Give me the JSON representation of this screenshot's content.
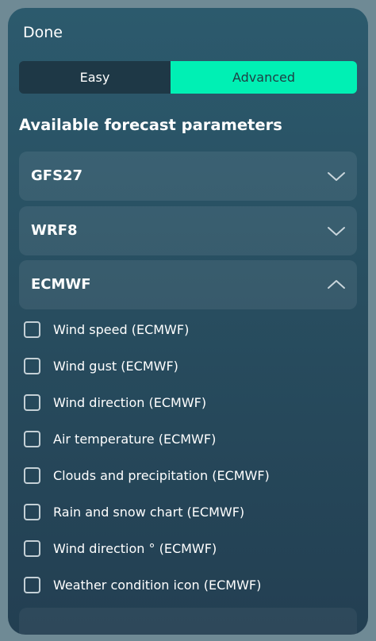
{
  "header": {
    "done_label": "Done"
  },
  "mode_switch": {
    "easy_label": "Easy",
    "advanced_label": "Advanced",
    "selected": "Advanced"
  },
  "section": {
    "title": "Available forecast parameters"
  },
  "models": [
    {
      "label": "GFS27",
      "expanded": false
    },
    {
      "label": "WRF8",
      "expanded": false
    },
    {
      "label": "ECMWF",
      "expanded": true
    }
  ],
  "ecmwf_params": [
    {
      "label": "Wind speed (ECMWF)",
      "checked": false
    },
    {
      "label": "Wind gust (ECMWF)",
      "checked": false
    },
    {
      "label": "Wind direction (ECMWF)",
      "checked": false
    },
    {
      "label": "Air temperature (ECMWF)",
      "checked": false
    },
    {
      "label": "Clouds and precipitation (ECMWF)",
      "checked": false
    },
    {
      "label": "Rain and snow chart (ECMWF)",
      "checked": false
    },
    {
      "label": "Wind direction ° (ECMWF)",
      "checked": false
    },
    {
      "label": "Weather condition icon (ECMWF)",
      "checked": false
    }
  ],
  "icons": {
    "collapsed": "chevron-down-icon",
    "expanded": "chevron-up-icon",
    "unchecked": "checkbox-empty-icon"
  },
  "colors": {
    "accent": "#00f0b4",
    "panel_top": "#2c5a6d",
    "panel_bottom": "#233f52",
    "segment_inactive": "#1e3846"
  }
}
